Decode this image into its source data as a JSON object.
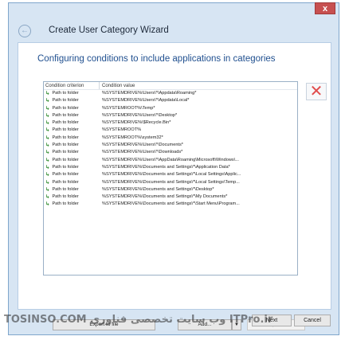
{
  "window": {
    "close_label": "x",
    "back_icon": "back-arrow-icon",
    "title": "Create User Category Wizard"
  },
  "content": {
    "heading": "Configuring conditions to include applications in categories"
  },
  "list": {
    "columns": [
      "Condition criterion",
      "Condition value"
    ],
    "rows": [
      {
        "criterion": "Path to folder",
        "value": "%SYSTEMDRIVE%\\Users\\*\\Appdata\\Roaming*"
      },
      {
        "criterion": "Path to folder",
        "value": "%SYSTEMDRIVE%\\Users\\*\\Appdata\\Local*"
      },
      {
        "criterion": "Path to folder",
        "value": "%SYSTEMROOT%\\Temp*"
      },
      {
        "criterion": "Path to folder",
        "value": "%SYSTEMDRIVE%\\Users\\*\\Desktop*"
      },
      {
        "criterion": "Path to folder",
        "value": "%SYSTEMDRIVE%\\$Recycle.Bin*"
      },
      {
        "criterion": "Path to folder",
        "value": "%SYSTEMROOT%"
      },
      {
        "criterion": "Path to folder",
        "value": "%SYSTEMROOT%\\system32*"
      },
      {
        "criterion": "Path to folder",
        "value": "%SYSTEMDRIVE%\\Users\\*\\Documents*"
      },
      {
        "criterion": "Path to folder",
        "value": "%SYSTEMDRIVE%\\Users\\*\\Downloads*"
      },
      {
        "criterion": "Path to folder",
        "value": "%SYSTEMDRIVE%\\Users\\*\\AppData\\Roaming\\Microsoft\\Windows\\..."
      },
      {
        "criterion": "Path to folder",
        "value": "%SYSTEMDRIVE%\\Documents and Settings\\*\\Application Data*"
      },
      {
        "criterion": "Path to folder",
        "value": "%SYSTEMDRIVE%\\Documents and Settings\\*\\Local Settings\\Applic..."
      },
      {
        "criterion": "Path to folder",
        "value": "%SYSTEMDRIVE%\\Documents and Settings\\*\\Local Settings\\Temp..."
      },
      {
        "criterion": "Path to folder",
        "value": "%SYSTEMDRIVE%\\Documents and Settings\\*\\Desktop*"
      },
      {
        "criterion": "Path to folder",
        "value": "%SYSTEMDRIVE%\\Documents and Settings\\*\\My Documents*"
      },
      {
        "criterion": "Path to folder",
        "value": "%SYSTEMDRIVE%\\Documents and Settings\\*\\Start Menu\\Program..."
      }
    ]
  },
  "actions": {
    "delete_icon": "red-x-delete-icon",
    "export_label": "Export to file",
    "add_label": "Add...",
    "add_dropdown_glyph": "▼",
    "properties_label": "Properties"
  },
  "footer": {
    "next_label": "Next",
    "cancel_label": "Cancel"
  },
  "watermark": {
    "text": "TOSINSO.COM وب سایت تخصصی فناوری ITPro.ir"
  }
}
